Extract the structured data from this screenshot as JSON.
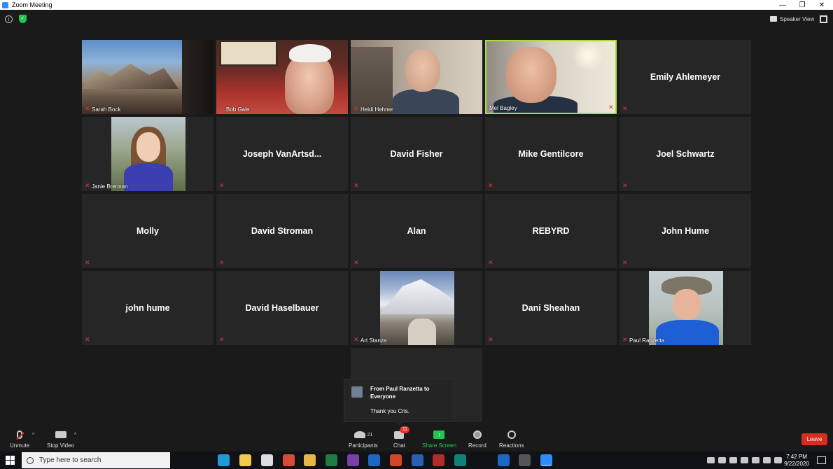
{
  "window": {
    "title": "Zoom Meeting",
    "controls": [
      "—",
      "❐",
      "✕"
    ]
  },
  "topbar": {
    "info_icon": "info-icon",
    "security_icon": "shield-check-icon",
    "view_label": "Speaker View"
  },
  "participants": [
    {
      "name": "Sarah Bock",
      "video": true,
      "photo": "landscape",
      "muted": true
    },
    {
      "name": "Bob Gale",
      "video": true,
      "photo": "bob",
      "muted": true
    },
    {
      "name": "Heidi Hehner",
      "video": true,
      "photo": "heidi",
      "muted": true
    },
    {
      "name": "Mel Bagley",
      "video": true,
      "photo": "mel",
      "muted": false,
      "active_speaker": true
    },
    {
      "name": "Emily Ahlemeyer",
      "video": false,
      "muted": true
    },
    {
      "name": "Janie Brennan",
      "video": true,
      "photo": "janie",
      "muted": true
    },
    {
      "name": "Joseph  VanArtsd...",
      "video": false,
      "muted": true
    },
    {
      "name": "David Fisher",
      "video": false,
      "muted": true
    },
    {
      "name": "Mike Gentilcore",
      "video": false,
      "muted": true
    },
    {
      "name": "Joel Schwartz",
      "video": false,
      "muted": true
    },
    {
      "name": "Molly",
      "video": false,
      "muted": true
    },
    {
      "name": "David Stroman",
      "video": false,
      "muted": true
    },
    {
      "name": "Alan",
      "video": false,
      "muted": true
    },
    {
      "name": "REBYRD",
      "video": false,
      "muted": true
    },
    {
      "name": "John Hume",
      "video": false,
      "muted": true
    },
    {
      "name": "john hume",
      "video": false,
      "muted": true
    },
    {
      "name": "David Haselbauer",
      "video": false,
      "muted": true
    },
    {
      "name": "Art Stanze",
      "video": true,
      "photo": "art",
      "muted": true
    },
    {
      "name": "Dani Sheahan",
      "video": false,
      "muted": true
    },
    {
      "name": "Paul Ranzetta",
      "video": true,
      "photo": "paul",
      "muted": true
    },
    {
      "name": "",
      "video": false,
      "muted": false
    }
  ],
  "chat_popup": {
    "from": "From Paul Ranzetta to Everyone",
    "message": "Thank you Cris."
  },
  "toolbar": {
    "unmute": "Unmute",
    "stop_video": "Stop Video",
    "participants": "Participants",
    "participants_count": "21",
    "chat": "Chat",
    "chat_badge": "11",
    "share_screen": "Share Screen",
    "record": "Record",
    "reactions": "Reactions",
    "leave": "Leave"
  },
  "taskbar": {
    "search_placeholder": "Type here to search",
    "time": "7:42 PM",
    "date": "9/22/2020",
    "apps": [
      {
        "name": "cortana-icon",
        "color": "#101216"
      },
      {
        "name": "task-view-icon",
        "color": "#101216"
      },
      {
        "name": "edge-icon",
        "color": "#1f9bd8"
      },
      {
        "name": "file-explorer-icon",
        "color": "#f2c94c"
      },
      {
        "name": "store-icon",
        "color": "#dddddd"
      },
      {
        "name": "chrome-icon",
        "color": "#d84a38"
      },
      {
        "name": "media-icon",
        "color": "#e6b84a"
      },
      {
        "name": "excel-icon",
        "color": "#1f7a44"
      },
      {
        "name": "onenote-icon",
        "color": "#7a3fa8"
      },
      {
        "name": "outlook-icon",
        "color": "#1d67c4"
      },
      {
        "name": "powerpoint-icon",
        "color": "#d24726"
      },
      {
        "name": "word-icon",
        "color": "#2b5fb4"
      },
      {
        "name": "access-icon",
        "color": "#b32b2b"
      },
      {
        "name": "publisher-icon",
        "color": "#0f8075"
      },
      {
        "name": "notifications-bell-icon",
        "color": "#101216"
      },
      {
        "name": "outlook2-icon",
        "color": "#1d67c4"
      },
      {
        "name": "app-icon",
        "color": "#555555"
      },
      {
        "name": "zoom-icon",
        "color": "#2d8cff"
      }
    ]
  },
  "colors": {
    "active_speaker_border": "#a8e03a",
    "muted": "#e0352b",
    "share_green": "#23c552",
    "leave_red": "#d62d20"
  }
}
